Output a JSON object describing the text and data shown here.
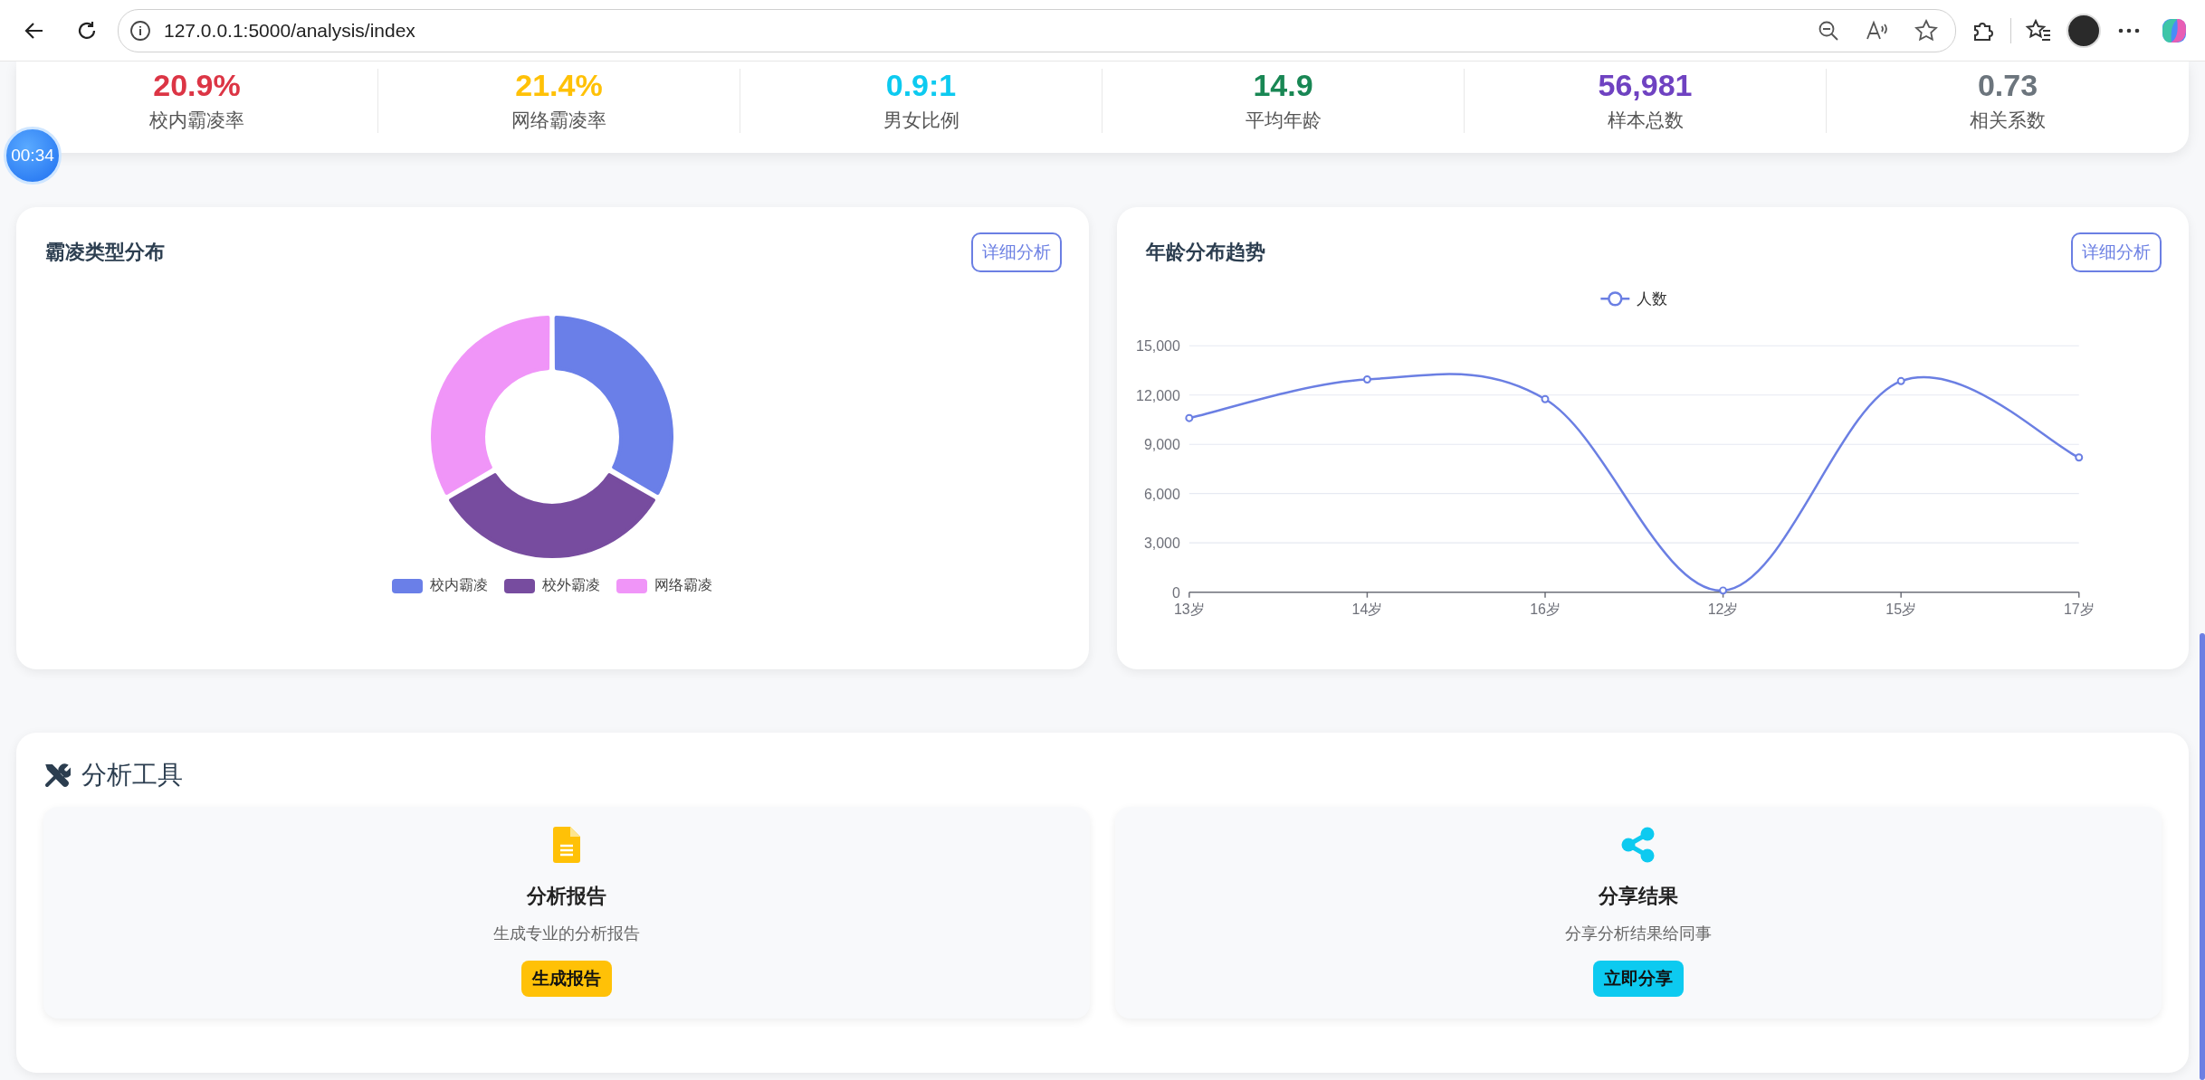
{
  "browser": {
    "url": "127.0.0.1:5000/analysis/index"
  },
  "timer": {
    "text": "00:34"
  },
  "stats": [
    {
      "value": "20.9%",
      "label": "校内霸凌率",
      "color": "#dc3545"
    },
    {
      "value": "21.4%",
      "label": "网络霸凌率",
      "color": "#ffc107"
    },
    {
      "value": "0.9:1",
      "label": "男女比例",
      "color": "#0dcaf0"
    },
    {
      "value": "14.9",
      "label": "平均年龄",
      "color": "#198754"
    },
    {
      "value": "56,981",
      "label": "样本总数",
      "color": "#6f42c1"
    },
    {
      "value": "0.73",
      "label": "相关系数",
      "color": "#6c757d"
    }
  ],
  "type_card": {
    "title": "霸凌类型分布",
    "button": "详细分析",
    "legend": [
      {
        "label": "校内霸凌",
        "color": "#6a7fe8"
      },
      {
        "label": "校外霸凌",
        "color": "#774c9f"
      },
      {
        "label": "网络霸凌",
        "color": "#f095f8"
      }
    ]
  },
  "age_card": {
    "title": "年龄分布趋势",
    "button": "详细分析",
    "chart_data": {
      "type": "line",
      "categories": [
        "13岁",
        "14岁",
        "16岁",
        "12岁",
        "15岁",
        "17岁"
      ],
      "series": [
        {
          "name": "人数",
          "color": "#6b7fe3",
          "marker": true,
          "values": [
            10600,
            12950,
            11750,
            100,
            12850,
            8200
          ]
        }
      ],
      "ylim": [
        0,
        15000
      ],
      "grid": true,
      "yticks": [
        {
          "value": 0,
          "label": "0"
        },
        {
          "value": 3000,
          "label": "3,000"
        },
        {
          "value": 6000,
          "label": "6,000"
        },
        {
          "value": 9000,
          "label": "9,000"
        },
        {
          "value": 12000,
          "label": "12,000"
        },
        {
          "value": 15000,
          "label": "15,000"
        }
      ]
    }
  },
  "tools": {
    "title": "分析工具",
    "items": [
      {
        "kind": "report",
        "title": "分析报告",
        "description": "生成专业的分析报告",
        "button": "生成报告",
        "color": "#ffc107"
      },
      {
        "kind": "share",
        "title": "分享结果",
        "description": "分享分析结果给同事",
        "button": "立即分享",
        "color": "#0dcaf0"
      }
    ]
  }
}
